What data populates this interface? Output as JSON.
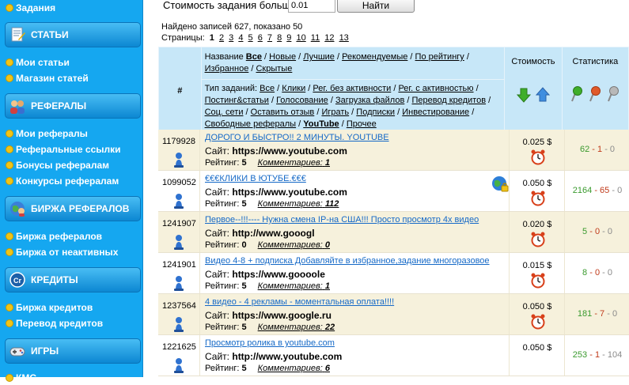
{
  "sidebar": {
    "top_item": "Задания",
    "sections": [
      {
        "title": "СТАТЬИ",
        "icon": "articles-icon",
        "items": [
          "Мои статьи",
          "Магазин статей"
        ]
      },
      {
        "title": "РЕФЕРАЛЫ",
        "icon": "referrals-icon",
        "items": [
          "Мои рефералы",
          "Реферальные ссылки",
          "Бонусы рефералам",
          "Конкурсы рефералам"
        ]
      },
      {
        "title": "БИРЖА РЕФЕРАЛОВ",
        "icon": "globe-exchange-icon",
        "items": [
          "Биржа рефералов",
          "Биржа от неактивных"
        ]
      },
      {
        "title": "КРЕДИТЫ",
        "icon": "credits-icon",
        "items": [
          "Биржа кредитов",
          "Перевод кредитов"
        ]
      },
      {
        "title": "ИГРЫ",
        "icon": "gamepad-icon",
        "items": []
      }
    ],
    "bottom_partial": "КМС"
  },
  "filter": {
    "label": "Стоимость задания больше",
    "value": "0.01",
    "button": "Найти"
  },
  "results": {
    "text": "Найдено записей 627, показано 50",
    "pages_label": "Страницы:",
    "pages": [
      "1",
      "2",
      "3",
      "4",
      "5",
      "6",
      "7",
      "8",
      "9",
      "10",
      "11",
      "12",
      "13"
    ],
    "current_page": "1"
  },
  "header": {
    "id_col": "#",
    "name_label": "Название",
    "name_links": [
      "Все",
      "Новые",
      "Лучшие",
      "Рекомендуемые",
      "По рейтингу",
      "Избранное",
      "Скрытые"
    ],
    "type_label": "Тип заданий:",
    "type_links": [
      "Все",
      "Клики",
      "Рег. без активности",
      "Рег. с активностью",
      "Постинг&статьи",
      "Голосование",
      "Загрузка файлов",
      "Перевод кредитов",
      "Соц. сети",
      "Оставить отзыв",
      "Играть",
      "Подписки",
      "Инвестирование",
      "Свободные рефералы",
      "YouTube",
      "Прочее"
    ],
    "cost_col": "Стоимость",
    "stats_col": "Статистика"
  },
  "tasks": [
    {
      "id": "1179928",
      "title": "ДОРОГО И БЫСТРО!! 2 МИНУТЫ. YOUTUBE",
      "site_label": "Сайт:",
      "site": "https://www.youtube.com",
      "rating_label": "Рейтинг:",
      "rating": "5",
      "comments_label": "Комментариев:",
      "comments": "1",
      "price": "0.025 $",
      "ok": "62",
      "bad": "1",
      "zero": "0",
      "globe": false
    },
    {
      "id": "1099052",
      "title": "€€€КЛИКИ В ЮТУБЕ.€€€",
      "site_label": "Сайт:",
      "site": "https://www.youtube.com",
      "rating_label": "Рейтинг:",
      "rating": "5",
      "comments_label": "Комментариев:",
      "comments": "112",
      "price": "0.050 $",
      "ok": "2164",
      "bad": "65",
      "zero": "0",
      "globe": true
    },
    {
      "id": "1241907",
      "title": "Первое--!!!---- Нужна смена IP-на США!!! Просто просмотр 4х видео",
      "site_label": "Сайт:",
      "site": "http://www.gooogl",
      "rating_label": "Рейтинг:",
      "rating": "0",
      "comments_label": "Комментариев:",
      "comments": "0",
      "price": "0.020 $",
      "ok": "5",
      "bad": "0",
      "zero": "0",
      "globe": false
    },
    {
      "id": "1241901",
      "title": "Видео 4-8 + подписка Добавляйте в избранное,задание многоразовое",
      "site_label": "Сайт:",
      "site": "https://www.goooole",
      "rating_label": "Рейтинг:",
      "rating": "5",
      "comments_label": "Комментариев:",
      "comments": "1",
      "price": "0.015 $",
      "ok": "8",
      "bad": "0",
      "zero": "0",
      "globe": false
    },
    {
      "id": "1237564",
      "title": "4 видео - 4 рекламы - моментальная оплата!!!!",
      "site_label": "Сайт:",
      "site": "https://www.google.ru",
      "rating_label": "Рейтинг:",
      "rating": "5",
      "comments_label": "Комментариев:",
      "comments": "22",
      "price": "0.050 $",
      "ok": "181",
      "bad": "7",
      "zero": "0",
      "globe": false
    },
    {
      "id": "1221625",
      "title": "Просмотр ролика в youtube.com",
      "site_label": "Сайт:",
      "site": "http://www.youtube.com",
      "rating_label": "Рейтинг:",
      "rating": "5",
      "comments_label": "Комментариев:",
      "comments": "6",
      "price": "0.050 $",
      "ok": "253",
      "bad": "1",
      "zero": "104",
      "globe": false
    }
  ],
  "colors": {
    "sidebar": "#15a7f0",
    "header": "#c7e7f8",
    "row_alt": "#f6f1dc",
    "link": "#1569c7",
    "ok": "#3a9a2e",
    "bad": "#c03a1a"
  }
}
